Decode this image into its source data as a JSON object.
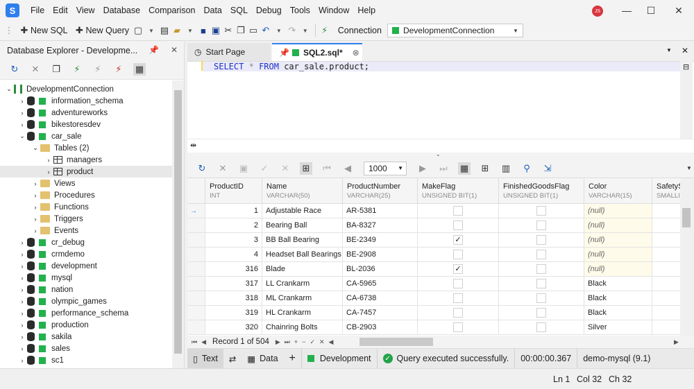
{
  "menu": [
    "File",
    "Edit",
    "View",
    "Database",
    "Comparison",
    "Data",
    "SQL",
    "Debug",
    "Tools",
    "Window",
    "Help"
  ],
  "user_initials": "JS",
  "toolbar": {
    "new_sql": "New SQL",
    "new_query": "New Query",
    "connection_label": "Connection",
    "connection_value": "DevelopmentConnection"
  },
  "db_explorer": {
    "title": "Database Explorer - Developme...",
    "tree": [
      {
        "label": "DevelopmentConnection",
        "kind": "connection",
        "level": 0,
        "expanded": true
      },
      {
        "label": "information_schema",
        "kind": "db",
        "level": 1
      },
      {
        "label": "adventureworks",
        "kind": "db",
        "level": 1
      },
      {
        "label": "bikestoresdev",
        "kind": "db",
        "level": 1
      },
      {
        "label": "car_sale",
        "kind": "db",
        "level": 1,
        "expanded": true
      },
      {
        "label": "Tables (2)",
        "kind": "folder-open",
        "level": 2,
        "expanded": true
      },
      {
        "label": "managers",
        "kind": "table",
        "level": 3
      },
      {
        "label": "product",
        "kind": "table",
        "level": 3,
        "selected": true
      },
      {
        "label": "Views",
        "kind": "folder",
        "level": 2
      },
      {
        "label": "Procedures",
        "kind": "folder",
        "level": 2
      },
      {
        "label": "Functions",
        "kind": "folder",
        "level": 2
      },
      {
        "label": "Triggers",
        "kind": "folder",
        "level": 2
      },
      {
        "label": "Events",
        "kind": "folder",
        "level": 2
      },
      {
        "label": "cr_debug",
        "kind": "db",
        "level": 1
      },
      {
        "label": "crmdemo",
        "kind": "db",
        "level": 1
      },
      {
        "label": "development",
        "kind": "db",
        "level": 1
      },
      {
        "label": "mysql",
        "kind": "db",
        "level": 1
      },
      {
        "label": "nation",
        "kind": "db",
        "level": 1
      },
      {
        "label": "olympic_games",
        "kind": "db",
        "level": 1
      },
      {
        "label": "performance_schema",
        "kind": "db",
        "level": 1
      },
      {
        "label": "production",
        "kind": "db",
        "level": 1
      },
      {
        "label": "sakila",
        "kind": "db",
        "level": 1
      },
      {
        "label": "sales",
        "kind": "db",
        "level": 1
      },
      {
        "label": "sc1",
        "kind": "db",
        "level": 1
      }
    ]
  },
  "tabs": {
    "start": "Start Page",
    "sql": "SQL2.sql*"
  },
  "editor": {
    "keyword_select": "SELECT",
    "star": "*",
    "keyword_from": "FROM",
    "table_ref": "car_sale.product;"
  },
  "grid_toolbar": {
    "page_size": "1000"
  },
  "grid": {
    "columns": [
      {
        "name": "ProductID",
        "type": "INT"
      },
      {
        "name": "Name",
        "type": "VARCHAR(50)"
      },
      {
        "name": "ProductNumber",
        "type": "VARCHAR(25)"
      },
      {
        "name": "MakeFlag",
        "type": "UNSIGNED BIT(1)"
      },
      {
        "name": "FinishedGoodsFlag",
        "type": "UNSIGNED BIT(1)"
      },
      {
        "name": "Color",
        "type": "VARCHAR(15)"
      },
      {
        "name": "SafetyStoc",
        "type": "SMALLINT"
      }
    ],
    "rows": [
      {
        "id": "1",
        "name": "Adjustable Race",
        "number": "AR-5381",
        "make": false,
        "finished": false,
        "color": "(null)"
      },
      {
        "id": "2",
        "name": "Bearing Ball",
        "number": "BA-8327",
        "make": false,
        "finished": false,
        "color": "(null)"
      },
      {
        "id": "3",
        "name": "BB Ball Bearing",
        "number": "BE-2349",
        "make": true,
        "finished": false,
        "color": "(null)"
      },
      {
        "id": "4",
        "name": "Headset Ball Bearings",
        "number": "BE-2908",
        "make": false,
        "finished": false,
        "color": "(null)"
      },
      {
        "id": "316",
        "name": "Blade",
        "number": "BL-2036",
        "make": true,
        "finished": false,
        "color": "(null)"
      },
      {
        "id": "317",
        "name": "LL Crankarm",
        "number": "CA-5965",
        "make": false,
        "finished": false,
        "color": "Black"
      },
      {
        "id": "318",
        "name": "ML Crankarm",
        "number": "CA-6738",
        "make": false,
        "finished": false,
        "color": "Black"
      },
      {
        "id": "319",
        "name": "HL Crankarm",
        "number": "CA-7457",
        "make": false,
        "finished": false,
        "color": "Black"
      },
      {
        "id": "320",
        "name": "Chainring Bolts",
        "number": "CB-2903",
        "make": false,
        "finished": false,
        "color": "Silver"
      }
    ],
    "check_glyph": "✓"
  },
  "record_nav": {
    "label": "Record 1 of 504"
  },
  "result_bar": {
    "text": "Text",
    "data": "Data",
    "env": "Development",
    "status": "Query executed successfully.",
    "elapsed": "00:00:00.367",
    "server": "demo-mysql (9.1)"
  },
  "status": {
    "ln": "Ln 1",
    "col": "Col 32",
    "ch": "Ch 32"
  },
  "colors": {
    "accent": "#2f80ed",
    "green": "#22b14c",
    "keyword": "#1f30c8"
  }
}
